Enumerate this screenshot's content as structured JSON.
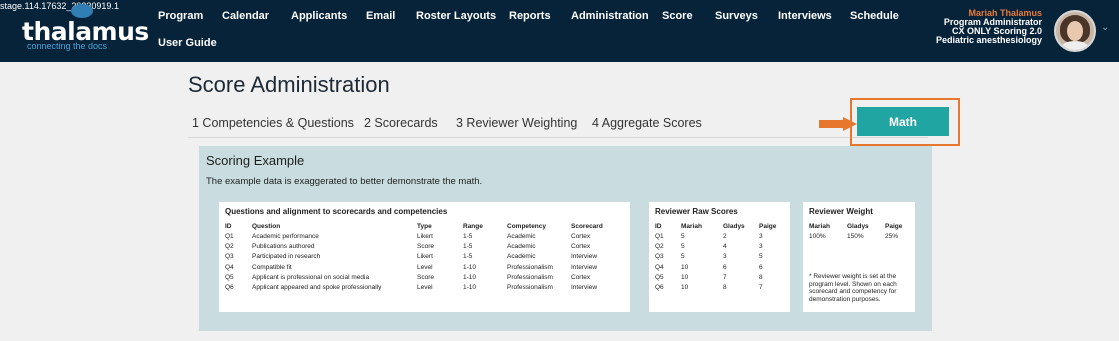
{
  "build_label": "stage.114.17632_20230919.1",
  "logo": {
    "name": "thalamus",
    "tagline": "connecting the docs"
  },
  "nav": {
    "items": [
      "Program",
      "Calendar",
      "Applicants",
      "Email",
      "Roster Layouts",
      "Reports",
      "Administration",
      "Score",
      "Surveys",
      "Interviews",
      "Schedule",
      "User Guide"
    ]
  },
  "user": {
    "name": "Mariah Thalamus",
    "role": "Program Administrator",
    "org": "CX ONLY Scoring 2.0",
    "program": "Pediatric anesthesiology"
  },
  "page": {
    "title": "Score Administration"
  },
  "tabs": [
    "1 Competencies & Questions",
    "2 Scorecards",
    "3 Reviewer Weighting",
    "4 Aggregate Scores"
  ],
  "math_button": {
    "label": "Math"
  },
  "colors": {
    "topbar": "#06233a",
    "accent_orange": "#e8772e",
    "teal_button": "#20a5a2",
    "panel_bg": "#c9dde0"
  },
  "example": {
    "title": "Scoring Example",
    "subtitle": "The example data is exaggerated to better demonstrate the math.",
    "questions": {
      "title": "Questions and alignment to scorecards and competencies",
      "headers": [
        "ID",
        "Question",
        "Type",
        "Range",
        "Competency",
        "Scorecard"
      ],
      "rows": [
        [
          "Q1",
          "Academic performance",
          "Likert",
          "1-5",
          "Academic",
          "Cortex"
        ],
        [
          "Q2",
          "Publications authored",
          "Score",
          "1-5",
          "Academic",
          "Cortex"
        ],
        [
          "Q3",
          "Participated in research",
          "Likert",
          "1-5",
          "Academic",
          "Interview"
        ],
        [
          "Q4",
          "Compatible fit",
          "Level",
          "1-10",
          "Professionalism",
          "Interview"
        ],
        [
          "Q5",
          "Applicant is professional on social media",
          "Score",
          "1-10",
          "Professionalism",
          "Cortex"
        ],
        [
          "Q6",
          "Applicant appeared and spoke professionally",
          "Level",
          "1-10",
          "Professionalism",
          "Interview"
        ]
      ]
    },
    "raw_scores": {
      "title": "Reviewer Raw Scores",
      "headers": [
        "ID",
        "Mariah",
        "Gladys",
        "Paige"
      ],
      "rows": [
        [
          "Q1",
          "5",
          "2",
          "3"
        ],
        [
          "Q2",
          "5",
          "4",
          "3"
        ],
        [
          "Q3",
          "5",
          "3",
          "5"
        ],
        [
          "Q4",
          "10",
          "6",
          "6"
        ],
        [
          "Q5",
          "10",
          "7",
          "8"
        ],
        [
          "Q6",
          "10",
          "8",
          "7"
        ]
      ]
    },
    "weight": {
      "title": "Reviewer Weight",
      "headers": [
        "Mariah",
        "Gladys",
        "Paige"
      ],
      "values": [
        "100%",
        "150%",
        "25%"
      ],
      "note": "* Reviewer weight is set at the program level. Shown on each scorecard and competency for demonstration purposes."
    }
  }
}
